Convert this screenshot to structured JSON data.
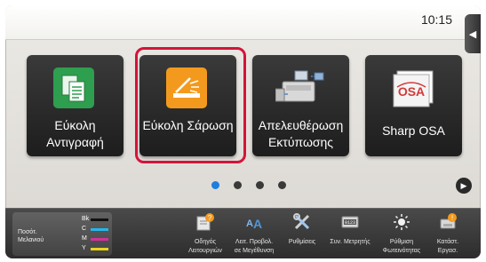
{
  "status": {
    "time": "10:15"
  },
  "tiles": [
    {
      "label": "Εύκολη Αντιγραφή",
      "icon": "copy-icon",
      "color": "#2e9e4f"
    },
    {
      "label": "Εύκολη Σάρωση",
      "icon": "scan-icon",
      "color": "#f39a1e"
    },
    {
      "label": "Απελευθέρωση Εκτύπωσης",
      "icon": "print-release-icon"
    },
    {
      "label": "Sharp OSA",
      "icon": "sharp-osa-icon"
    }
  ],
  "pager": {
    "pages": 4,
    "current": 1
  },
  "toner": {
    "title_line1": "Ποσότ.",
    "title_line2": "Μελανιού",
    "rows": [
      {
        "label": "Bk",
        "color": "#111111"
      },
      {
        "label": "C",
        "color": "#25b6e8"
      },
      {
        "label": "M",
        "color": "#d0329a"
      },
      {
        "label": "Y",
        "color": "#e8d320"
      }
    ]
  },
  "bottom_items": [
    {
      "line1": "Οδηγός",
      "line2": "Λειτουργιών",
      "icon": "operation-guide-icon"
    },
    {
      "line1": "Λειτ. Προβολ.",
      "line2": "σε Μεγέθυνση",
      "icon": "enlarge-display-icon"
    },
    {
      "line1": "Ρυθμίσεις",
      "line2": "",
      "icon": "settings-icon"
    },
    {
      "line1": "Συν. Μετρητής",
      "line2": "",
      "icon": "total-count-icon"
    },
    {
      "line1": "Ρύθμιση",
      "line2": "Φωτεινότητας",
      "icon": "brightness-icon"
    },
    {
      "line1": "Κατάστ.",
      "line2": "Εργασ.",
      "icon": "job-status-icon"
    }
  ],
  "colors": {
    "highlight": "#d4143a",
    "pager_active": "#1d7fe0"
  }
}
